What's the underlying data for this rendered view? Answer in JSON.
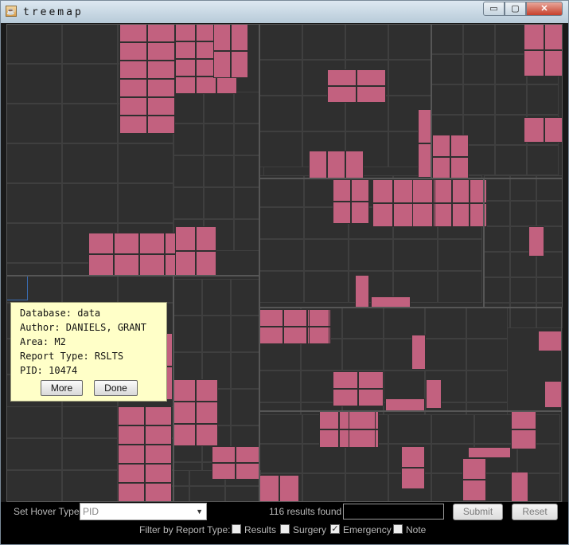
{
  "window": {
    "title": "treemap",
    "minimize_glyph": "▭",
    "maximize_glyph": "▢",
    "close_glyph": "✕"
  },
  "tooltip": {
    "database": "Database: data",
    "author": "Author: DANIELS, GRANT",
    "area": "Area: M2",
    "report_type": "Report Type: RSLTS",
    "pid": "PID: 10474",
    "more_label": "More",
    "done_label": "Done"
  },
  "controls": {
    "hover_label": "Set Hover Type:",
    "hover_value": "PID",
    "results_text": "116 results found",
    "search_value": "",
    "submit_label": "Submit",
    "reset_label": "Reset",
    "filter_label": "Filter by Report Type:",
    "filters": [
      {
        "label": "Results",
        "checked": false
      },
      {
        "label": "Surgery",
        "checked": false
      },
      {
        "label": "Emergency",
        "checked": true
      },
      {
        "label": "Note",
        "checked": false
      }
    ]
  },
  "colors": {
    "highlight": "#c2617f",
    "tile": "#2f2f2f",
    "background": "#000000"
  }
}
